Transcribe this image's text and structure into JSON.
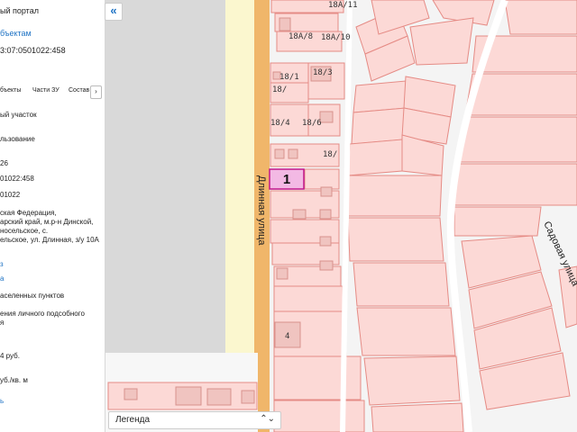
{
  "sidebar": {
    "portal_title": "ый портал",
    "objects_link": "бъектам",
    "cad_number": "3:07:0501022:458",
    "tabs": [
      "бъекты",
      "Части ЗУ",
      "Состав"
    ],
    "next_tab": "›",
    "lines": [
      {
        "text": "ый участок",
        "link": false
      },
      {
        "text": "льзование",
        "link": false
      },
      {
        "text": "26",
        "link": false
      },
      {
        "text": "01022:458",
        "link": false
      },
      {
        "text": "01022",
        "link": false
      },
      {
        "text": "ская Федерация,",
        "link": false
      },
      {
        "text": "арский край, м.р-н Динской,",
        "link": false
      },
      {
        "text": "носельское, с.",
        "link": false
      },
      {
        "text": "ельское, ул. Длинная, з/у 10А",
        "link": false
      },
      {
        "text": "з",
        "link": true
      },
      {
        "text": "а",
        "link": true
      },
      {
        "text": "аселенных пунктов",
        "link": false
      },
      {
        "text": "ения личного подсобного",
        "link": false
      },
      {
        "text": "я",
        "link": false
      },
      {
        "text": "4 руб.",
        "link": false
      },
      {
        "text": "уб./кв. м",
        "link": false
      },
      {
        "text": "ь",
        "link": true
      }
    ]
  },
  "map": {
    "collapse_icon": "«",
    "parcel_labels": [
      "18А/11",
      "18А/8",
      "18А/10",
      "18/1",
      "18/3",
      "18/",
      "18/4",
      "18/6",
      "18/",
      "4"
    ],
    "selected_parcel": "1",
    "streets": [
      "Длинная улица",
      "Садовая улица"
    ],
    "colors": {
      "parcel_fill": "#fcd9d6",
      "parcel_stroke": "#e58b85",
      "selected_fill": "#f3b9e4",
      "selected_stroke": "#c2178b",
      "road": "#f0b66a"
    }
  },
  "legend": {
    "label": "Легенда",
    "arrow": "⌃⌄"
  }
}
